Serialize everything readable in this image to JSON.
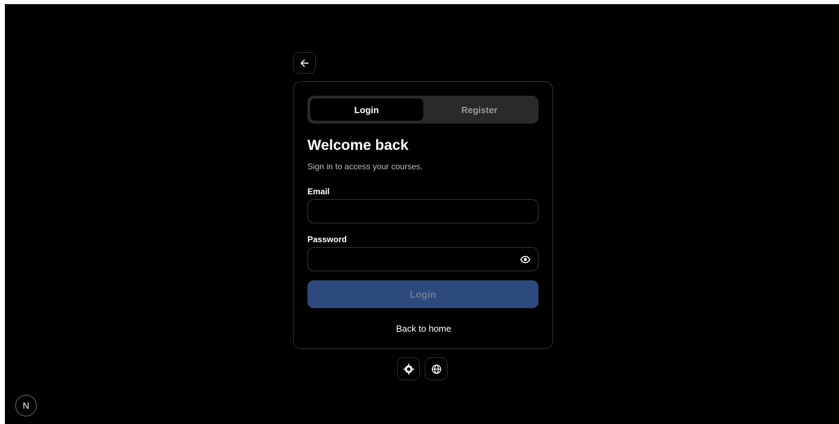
{
  "nav": {
    "back_icon": "arrow-left-icon"
  },
  "tabs": [
    {
      "label": "Login",
      "active": true
    },
    {
      "label": "Register",
      "active": false
    }
  ],
  "form": {
    "title": "Welcome back",
    "subtitle": "Sign in to access your courses.",
    "email_label": "Email",
    "email_value": "",
    "password_label": "Password",
    "password_value": "",
    "password_toggle_icon": "eye-icon",
    "submit_label": "Login",
    "back_home_label": "Back to home"
  },
  "footer": {
    "theme_icon": "sun-icon",
    "language_icon": "globe-icon"
  },
  "badge": {
    "label": "N"
  },
  "colors": {
    "background": "#000000",
    "card_border": "#2f2f2f",
    "tab_track": "#2a2a2a",
    "primary_button": "#2c4a7e"
  }
}
